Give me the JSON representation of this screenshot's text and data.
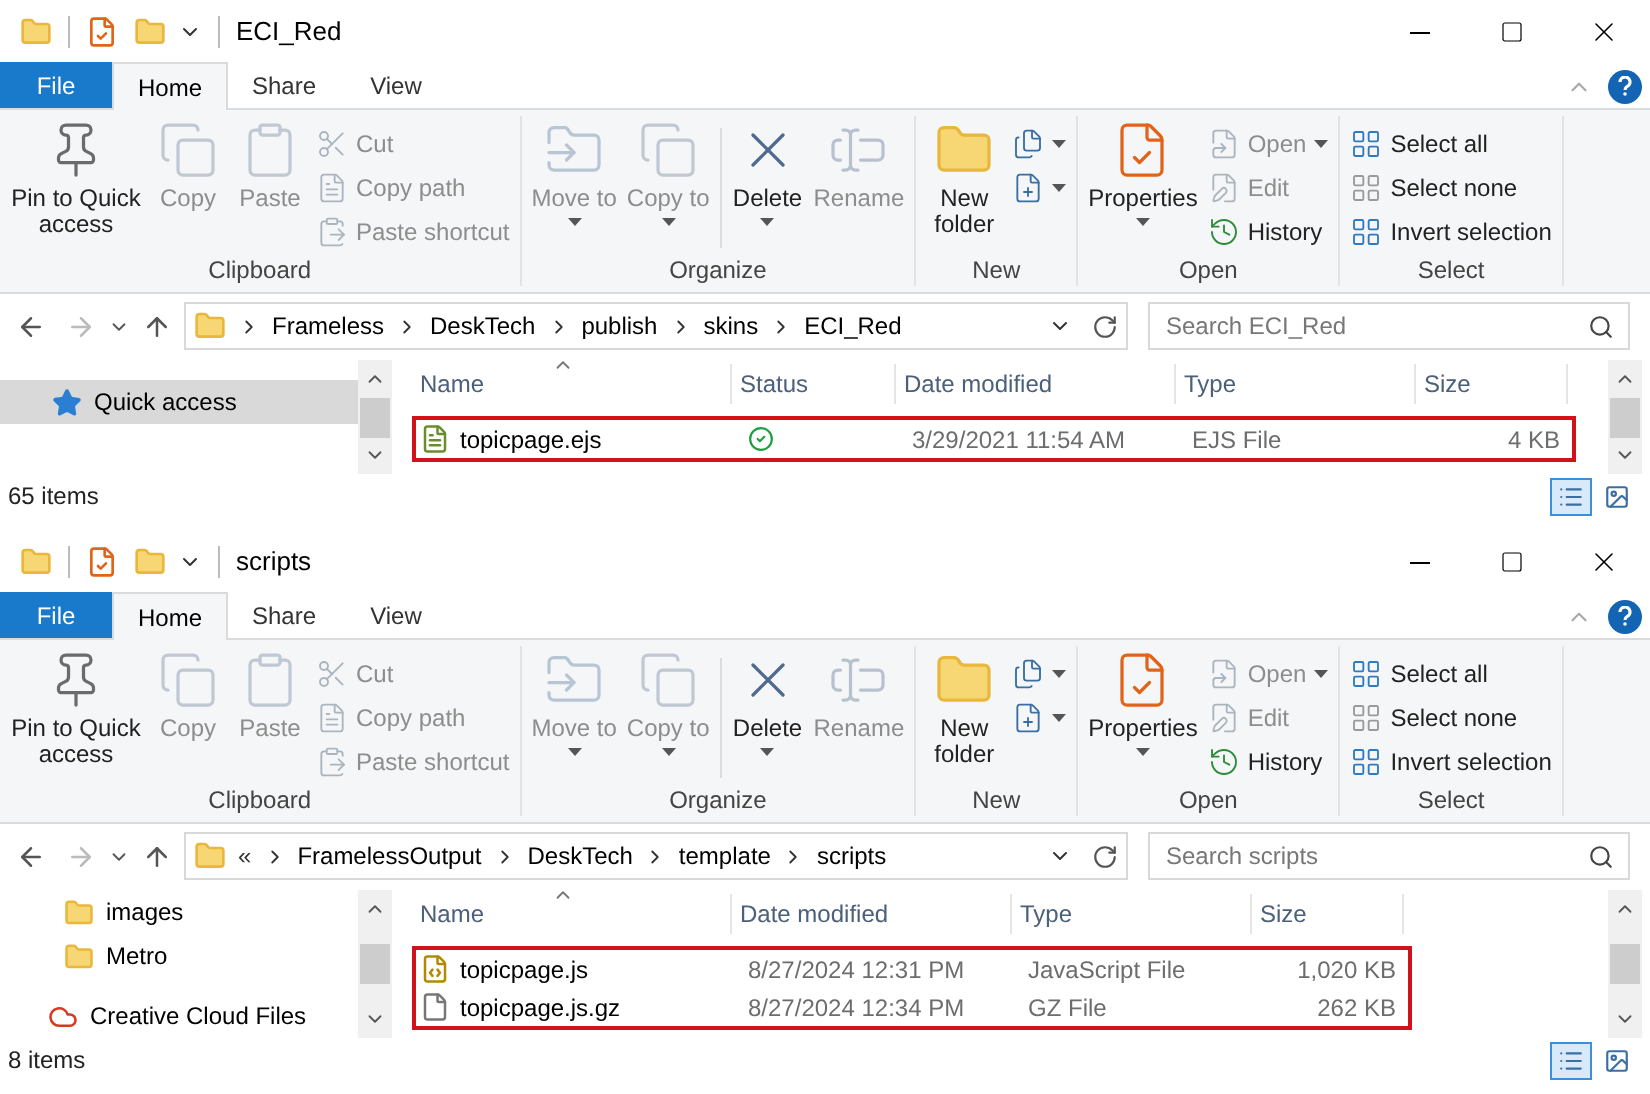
{
  "windows": [
    {
      "title": "ECI_Red",
      "tabs": [
        {
          "label": "File",
          "kind": "file",
          "selected": false
        },
        {
          "label": "Home",
          "kind": "tab",
          "selected": true
        },
        {
          "label": "Share",
          "kind": "tab",
          "selected": false
        },
        {
          "label": "View",
          "kind": "tab",
          "selected": false
        }
      ],
      "ribbon": [
        {
          "label": "Clipboard",
          "large": [
            {
              "label": "Pin to Quick access",
              "disabled": false
            },
            {
              "label": "Copy",
              "disabled": true
            },
            {
              "label": "Paste",
              "disabled": true
            }
          ],
          "small": [
            {
              "label": "Cut",
              "disabled": true
            },
            {
              "label": "Copy path",
              "disabled": true
            },
            {
              "label": "Paste shortcut",
              "disabled": true
            }
          ]
        },
        {
          "label": "Organize",
          "large": [
            {
              "label": "Move to",
              "disabled": true,
              "dropdown": true
            },
            {
              "label": "Copy to",
              "disabled": true,
              "dropdown": true
            },
            {
              "label": "Delete",
              "disabled": false,
              "dropdown": true
            },
            {
              "label": "Rename",
              "disabled": true
            }
          ]
        },
        {
          "label": "New",
          "large": [
            {
              "label": "New folder",
              "disabled": false
            }
          ],
          "small": [
            {
              "disabled": false,
              "dropdown": true
            },
            {
              "disabled": false,
              "dropdown": true
            }
          ]
        },
        {
          "label": "Open",
          "large": [
            {
              "label": "Properties",
              "disabled": false,
              "dropdown": true
            }
          ],
          "small": [
            {
              "label": "Open",
              "disabled": true,
              "dropdown": true
            },
            {
              "label": "Edit",
              "disabled": true
            },
            {
              "label": "History",
              "disabled": false
            }
          ]
        },
        {
          "label": "Select",
          "small": [
            {
              "label": "Select all",
              "disabled": false
            },
            {
              "label": "Select none",
              "disabled": false
            },
            {
              "label": "Invert selection",
              "disabled": false
            }
          ]
        }
      ],
      "address": {
        "crumbs": [
          "Frameless",
          "DeskTech",
          "publish",
          "skins",
          "ECI_Red"
        ]
      },
      "search": {
        "placeholder": "Search ECI_Red"
      },
      "nav": [
        {
          "label": "Quick access",
          "kind": "pinned",
          "selected": true
        }
      ],
      "files": {
        "outlined": true,
        "columns": [
          {
            "label": "Name",
            "kind": "name",
            "sorted": true
          },
          {
            "label": "Status",
            "kind": "status",
            "sorted": false
          },
          {
            "label": "Date modified",
            "kind": "date",
            "sorted": false
          },
          {
            "label": "Type",
            "kind": "type",
            "sorted": false
          },
          {
            "label": "Size",
            "kind": "size",
            "sorted": false
          }
        ],
        "rows": [
          {
            "name": "topicpage.ejs",
            "kind": "ejs",
            "synced": true,
            "date": "3/29/2021 11:54 AM",
            "type": "EJS File",
            "size": "4 KB"
          }
        ]
      },
      "status_bar": {
        "count": "65 items"
      },
      "view_buttons": [
        {
          "selected": true
        },
        {
          "selected": false
        }
      ]
    },
    {
      "title": "scripts",
      "tabs": [
        {
          "label": "File",
          "kind": "file",
          "selected": false
        },
        {
          "label": "Home",
          "kind": "tab",
          "selected": true
        },
        {
          "label": "Share",
          "kind": "tab",
          "selected": false
        },
        {
          "label": "View",
          "kind": "tab",
          "selected": false
        }
      ],
      "ribbon": [
        {
          "label": "Clipboard",
          "large": [
            {
              "label": "Pin to Quick access",
              "disabled": false
            },
            {
              "label": "Copy",
              "disabled": true
            },
            {
              "label": "Paste",
              "disabled": true
            }
          ],
          "small": [
            {
              "label": "Cut",
              "disabled": true
            },
            {
              "label": "Copy path",
              "disabled": true
            },
            {
              "label": "Paste shortcut",
              "disabled": true
            }
          ]
        },
        {
          "label": "Organize",
          "large": [
            {
              "label": "Move to",
              "disabled": true,
              "dropdown": true
            },
            {
              "label": "Copy to",
              "disabled": true,
              "dropdown": true
            },
            {
              "label": "Delete",
              "disabled": false,
              "dropdown": true
            },
            {
              "label": "Rename",
              "disabled": true
            }
          ]
        },
        {
          "label": "New",
          "large": [
            {
              "label": "New folder",
              "disabled": false
            }
          ],
          "small": [
            {
              "disabled": false,
              "dropdown": true
            },
            {
              "disabled": false,
              "dropdown": true
            }
          ]
        },
        {
          "label": "Open",
          "large": [
            {
              "label": "Properties",
              "disabled": false,
              "dropdown": true
            }
          ],
          "small": [
            {
              "label": "Open",
              "disabled": true,
              "dropdown": true
            },
            {
              "label": "Edit",
              "disabled": true
            },
            {
              "label": "History",
              "disabled": false
            }
          ]
        },
        {
          "label": "Select",
          "small": [
            {
              "label": "Select all",
              "disabled": false
            },
            {
              "label": "Select none",
              "disabled": false
            },
            {
              "label": "Invert selection",
              "disabled": false
            }
          ]
        }
      ],
      "address": {
        "overflow": "«",
        "crumbs": [
          "FramelessOutput",
          "DeskTech",
          "template",
          "scripts"
        ]
      },
      "search": {
        "placeholder": "Search scripts"
      },
      "nav": [
        {
          "label": "images",
          "kind": "folder",
          "selected": false
        },
        {
          "label": "Metro",
          "kind": "folder",
          "selected": false
        },
        {
          "label": "Creative Cloud Files",
          "kind": "cloud",
          "selected": false
        }
      ],
      "files": {
        "outlined": true,
        "columns": [
          {
            "label": "Name",
            "kind": "name",
            "sorted": true
          },
          {
            "label": "Date modified",
            "kind": "date",
            "sorted": false
          },
          {
            "label": "Type",
            "kind": "type",
            "sorted": false
          },
          {
            "label": "Size",
            "kind": "size",
            "sorted": false
          }
        ],
        "rows": [
          {
            "name": "topicpage.js",
            "kind": "js",
            "date": "8/27/2024 12:31 PM",
            "type": "JavaScript File",
            "size": "1,020 KB"
          },
          {
            "name": "topicpage.js.gz",
            "kind": "gz",
            "date": "8/27/2024 12:34 PM",
            "type": "GZ File",
            "size": "262 KB"
          }
        ]
      },
      "status_bar": {
        "count": "8 items"
      },
      "view_buttons": [
        {
          "selected": true
        },
        {
          "selected": false
        }
      ]
    }
  ]
}
